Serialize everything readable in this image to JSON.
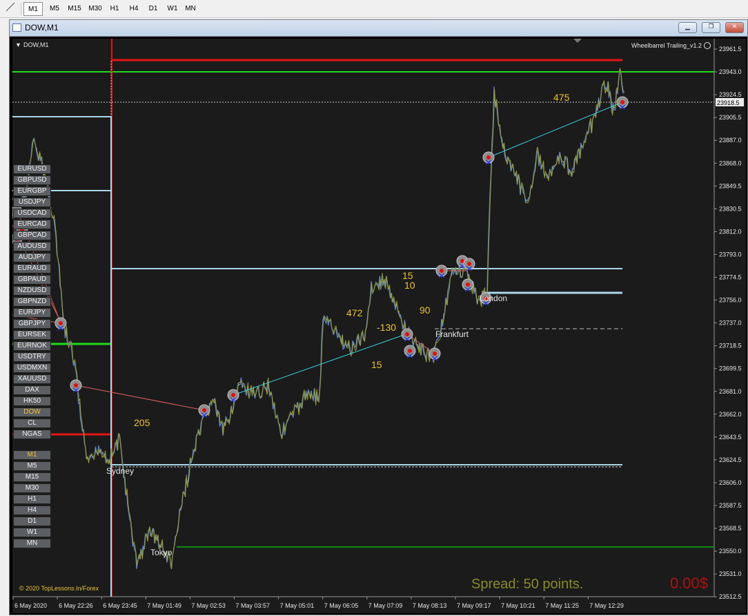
{
  "toolbar": {
    "timeframes": [
      "M1",
      "M5",
      "M15",
      "M30",
      "H1",
      "H4",
      "D1",
      "W1",
      "MN"
    ],
    "active": "M1"
  },
  "window": {
    "title": "DOW,M1",
    "controls": [
      "minimize",
      "restore",
      "close"
    ]
  },
  "chart": {
    "symbol_label": "DOW,M1",
    "indicator": "Wheelbarrel Trailing_v1.2",
    "current_price": "23918.5",
    "price_axis": [
      "23961.5",
      "23943.0",
      "23924.5",
      "23905.5",
      "23887.0",
      "23868.0",
      "23849.5",
      "23830.5",
      "23812.0",
      "23793.0",
      "23774.5",
      "23756.0",
      "23737.0",
      "23718.5",
      "23699.5",
      "23681.0",
      "23662.0",
      "23643.5",
      "23624.5",
      "23606.0",
      "23587.5",
      "23568.5",
      "23550.0",
      "23531.0",
      "23512.5"
    ],
    "time_axis": [
      "6 May 2020",
      "6 May 22:26",
      "6 May 23:45",
      "7 May 01:49",
      "7 May 02:53",
      "7 May 03:57",
      "7 May 05:01",
      "7 May 06:05",
      "7 May 07:09",
      "7 May 08:13",
      "7 May 09:17",
      "7 May 10:21",
      "7 May 11:25",
      "7 May 12:29"
    ],
    "sessions": [
      "Sydney",
      "Tokyo",
      "Frankfurt",
      "London"
    ],
    "trade_labels": [
      "475",
      "15",
      "10",
      "472",
      "90",
      "-130",
      "15",
      "205"
    ],
    "spread_text": "Spread: 50 points.",
    "profit_text": "0.00$",
    "copyright": "© 2020 TopLessons.In/Forex",
    "colors": {
      "green": "#22dd22",
      "red": "#e01010",
      "lightblue": "#a8d8ea",
      "gold": "#e9c42a",
      "spread": "#8a8a2a",
      "profit": "#b01010"
    }
  },
  "symbols": [
    "EURUSD",
    "GBPUSD",
    "EURGBP",
    "USDJPY",
    "USDCAD",
    "EURCAD",
    "GBPCAD",
    "AUDUSD",
    "AUDJPY",
    "EURAUD",
    "GBPAUD",
    "NZDUSD",
    "GBPNZD",
    "EURJPY",
    "GBPJPY",
    "EURSEK",
    "EURNOK",
    "USDTRY",
    "USDMXN",
    "XAUUSD",
    "DAX",
    "HK50",
    "DOW",
    "CL",
    "NGAS"
  ],
  "selected_symbol": "DOW",
  "timeframe_panel": [
    "M1",
    "M5",
    "M15",
    "M30",
    "H1",
    "H4",
    "D1",
    "W1",
    "MN"
  ],
  "selected_timeframe": "M1"
}
